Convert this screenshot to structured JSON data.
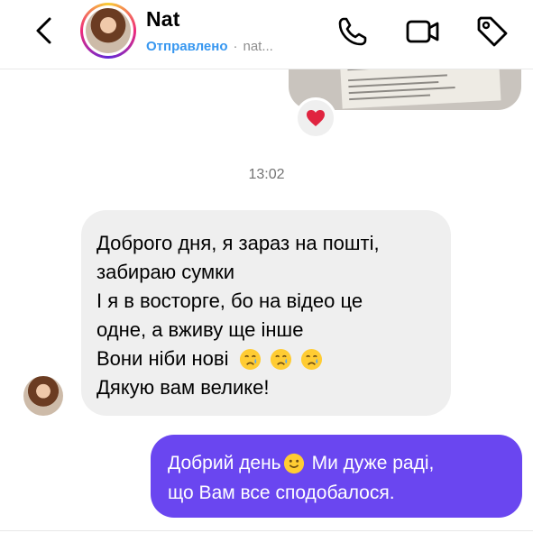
{
  "header": {
    "contact_name": "Nat",
    "status": "Отправлено",
    "separator": "·",
    "handle": "nat...",
    "back_icon": "chevron-left-icon",
    "call_icon": "phone-icon",
    "video_icon": "video-camera-icon",
    "tag_icon": "tag-icon"
  },
  "previous_message": {
    "type": "photo",
    "reaction": "❤️",
    "reaction_icon": "heart-icon"
  },
  "timestamp": "13:02",
  "incoming_message": {
    "lines": [
      "Доброго дня, я зараз на пошті,",
      "забираю сумки",
      "І я в восторге, бо на відео це",
      "одне, а вживу ще інше",
      "Вони ніби нові",
      "Дякую вам велике!"
    ],
    "emoji": [
      "crying-face-icon",
      "crying-face-icon",
      "crying-face-icon"
    ]
  },
  "outgoing_message": {
    "line1_before": "Добрий день",
    "line1_after": "Ми дуже раді,",
    "line2": "що Вам все сподобалося.",
    "emoji": "smiling-face-icon"
  },
  "colors": {
    "accent": "#3797f0",
    "outgoing_bubble": "#6a46f0",
    "incoming_bubble": "#efefef",
    "reaction_heart": "#e02440"
  }
}
